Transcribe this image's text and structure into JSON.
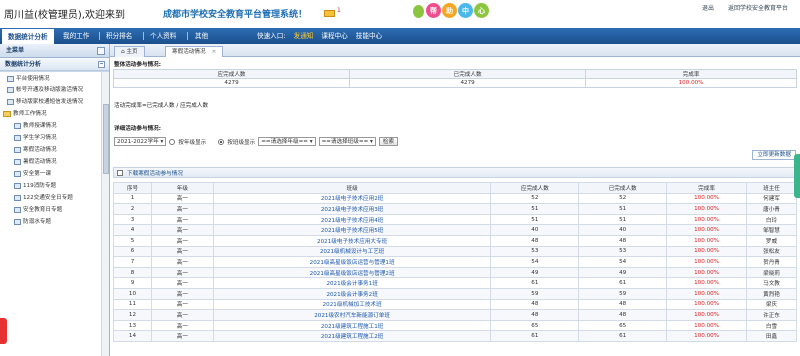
{
  "header": {
    "user_title": "周川益(校管理员),欢迎来到",
    "platform_title": "成都市学校安全教育平台管理系统！",
    "mail_count": "1",
    "help_chars": [
      "帮",
      "助",
      "中",
      "心"
    ],
    "help_colors": [
      "#f04d8c",
      "#f5a623",
      "#4ab8e8",
      "#8cc63f"
    ],
    "top_links": [
      "退出",
      "返回学校安全教育平台"
    ]
  },
  "nav": {
    "items": [
      "数据统计分析",
      "我的工作",
      "积分排名",
      "个人资料",
      "其他"
    ],
    "quick_label": "快速入口:",
    "quick_links": [
      "发通知",
      "课程中心",
      "技能中心"
    ]
  },
  "sidebar": {
    "header": "主菜单",
    "group": "数据统计分析",
    "items": [
      "平台使用情况",
      "帐号开通及移动版激活情况",
      "移动版家校通短信发送情况",
      "教师工作情况",
      "教师授课情况",
      "学生学习情况",
      "寒假活动情况",
      "暑假活动情况",
      "安全第一课",
      "119消防专题",
      "122交通安全日专题",
      "安全教育日专题",
      "防溺水专题"
    ]
  },
  "tabs": [
    "主页",
    "寒假活动情况"
  ],
  "summary": {
    "title": "整体活动参与情况:",
    "headers": [
      "应完成人数",
      "已完成人数",
      "完成率"
    ],
    "values": [
      "4279",
      "4279",
      "100.00%"
    ]
  },
  "note": "活动完成率=已完成人数 / 应完成人数",
  "detail": {
    "title": "详细活动参与情况:",
    "year": "2021-2022学年",
    "radio_grade": "按年级显示",
    "radio_class": "按班级显示",
    "grade_placeholder": "==请选择年级==",
    "class_placeholder": "==请选择班级==",
    "search": "检索",
    "update": "立即更新数据",
    "download": "下载寒假活动参与情况"
  },
  "table": {
    "headers": [
      "序号",
      "年级",
      "班级",
      "应完成人数",
      "已完成人数",
      "完成率",
      "班主任"
    ],
    "rows": [
      [
        "1",
        "高一",
        "2021级电子技术应用2班",
        "52",
        "52",
        "100.00%",
        "何建军"
      ],
      [
        "2",
        "高一",
        "2021级电子技术应用3班",
        "51",
        "51",
        "100.00%",
        "唐小青"
      ],
      [
        "3",
        "高一",
        "2021级电子技术应用4班",
        "51",
        "51",
        "100.00%",
        "白玲"
      ],
      [
        "4",
        "高一",
        "2021级电子技术应用5班",
        "40",
        "40",
        "100.00%",
        "邹智慧"
      ],
      [
        "5",
        "高一",
        "2021级电子技术应用大专班",
        "48",
        "48",
        "100.00%",
        "罗威"
      ],
      [
        "6",
        "高一",
        "2021级机械设计与工艺班",
        "53",
        "53",
        "100.00%",
        "张松友"
      ],
      [
        "7",
        "高一",
        "2021级高星级饭店运营与管理1班",
        "54",
        "54",
        "100.00%",
        "贺丹青"
      ],
      [
        "8",
        "高一",
        "2021级高星级饭店运营与管理2班",
        "49",
        "49",
        "100.00%",
        "梁晓莉"
      ],
      [
        "9",
        "高一",
        "2021级会计事务1班",
        "61",
        "61",
        "100.00%",
        "马文教"
      ],
      [
        "10",
        "高一",
        "2021级会计事务2班",
        "59",
        "59",
        "100.00%",
        "黄烈艳"
      ],
      [
        "11",
        "高一",
        "2021级机械加工技术班",
        "48",
        "48",
        "100.00%",
        "梁庆"
      ],
      [
        "12",
        "高一",
        "2021级农村汽车新能源订单班",
        "48",
        "48",
        "100.00%",
        "许正东"
      ],
      [
        "13",
        "高一",
        "2021级建筑工程施工1班",
        "65",
        "65",
        "100.00%",
        "白雪"
      ],
      [
        "14",
        "高一",
        "2021级建筑工程施工2班",
        "61",
        "61",
        "100.00%",
        "田鑫"
      ]
    ]
  }
}
